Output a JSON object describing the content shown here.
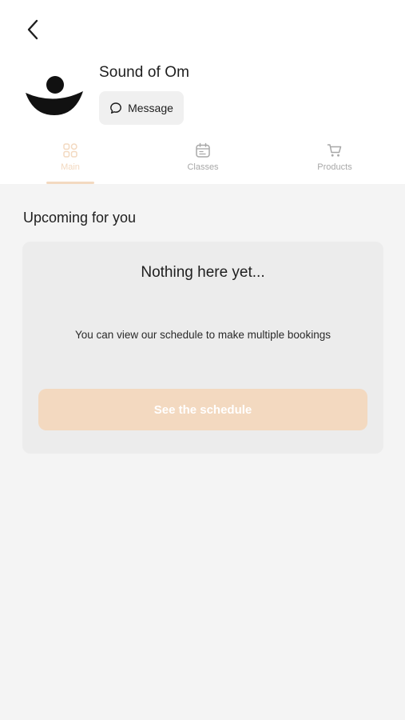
{
  "studio": {
    "name": "Sound of Om"
  },
  "actions": {
    "message_label": "Message"
  },
  "tabs": [
    {
      "label": "Main",
      "icon": "grid-icon",
      "active": true
    },
    {
      "label": "Classes",
      "icon": "calendar-icon",
      "active": false
    },
    {
      "label": "Products",
      "icon": "cart-icon",
      "active": false
    }
  ],
  "upcoming": {
    "title": "Upcoming for you",
    "empty_title": "Nothing here yet...",
    "empty_text": "You can view our schedule to make multiple bookings",
    "button_label": "See the schedule"
  },
  "colors": {
    "accent": "#f3d9c0",
    "background": "#f4f4f4",
    "card": "#ececec",
    "text": "#1e1e1e",
    "muted": "#a8a8a8"
  }
}
